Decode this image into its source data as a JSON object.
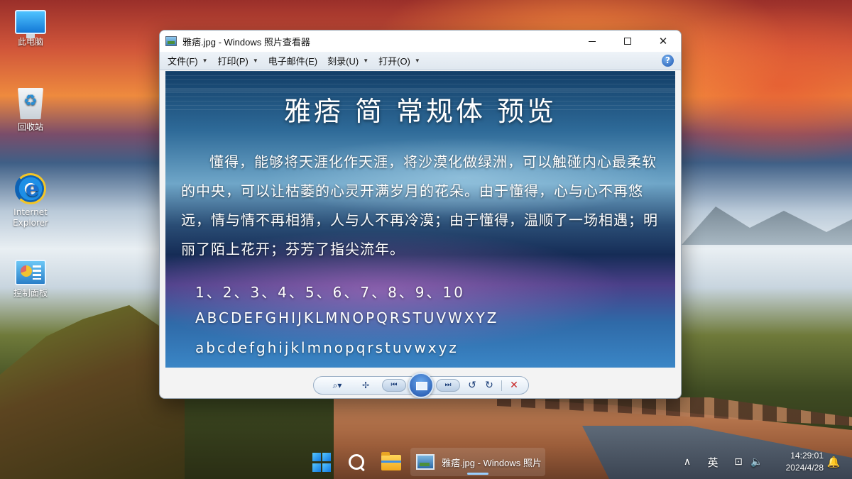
{
  "desktop": {
    "icons": [
      {
        "label": "此电脑"
      },
      {
        "label": "回收站"
      },
      {
        "label": "Internet Explorer"
      },
      {
        "label": "控制面板"
      }
    ]
  },
  "window": {
    "title": "雅痞.jpg - Windows 照片查看器",
    "controls": {
      "minimize": "—",
      "maximize": "□",
      "close": "✕"
    },
    "menu": [
      {
        "label": "文件(F)",
        "has_dropdown": true
      },
      {
        "label": "打印(P)",
        "has_dropdown": true
      },
      {
        "label": "电子邮件(E)",
        "has_dropdown": false
      },
      {
        "label": "刻录(U)",
        "has_dropdown": true
      },
      {
        "label": "打开(O)",
        "has_dropdown": true
      }
    ],
    "help_label": "?",
    "image": {
      "title": "雅痞 简 常规体 预览",
      "paragraph": "懂得，能够将天涯化作天涯，将沙漠化做绿洲，可以触碰内心最柔软的中央，可以让枯萎的心灵开满岁月的花朵。由于懂得，心与心不再悠远，情与情不再相猜，人与人不再冷漠；由于懂得，温顺了一场相遇；明丽了陌上花开；芬芳了指尖流年。",
      "numbers": "1、2、3、4、5、6、7、8、9、10",
      "uppercase": "ABCDEFGHIJKLMNOPQRSTUVWXYZ",
      "lowercase": "abcdefghijklmnopqrstuvwxyz"
    },
    "toolbar": {
      "zoom": "⌕▾",
      "fit": "✢",
      "prev": "⏮",
      "next": "⏭",
      "rotate_ccw": "↺",
      "rotate_cw": "↻",
      "delete": "✕"
    }
  },
  "taskbar": {
    "running_app_label": "雅痞.jpg - Windows 照片查看器",
    "tray": {
      "chevron": "∧",
      "ime": "英",
      "network": "⊡",
      "volume": "🔈",
      "time": "14:29:01",
      "date": "2024/4/28",
      "notification": "🔔"
    }
  }
}
